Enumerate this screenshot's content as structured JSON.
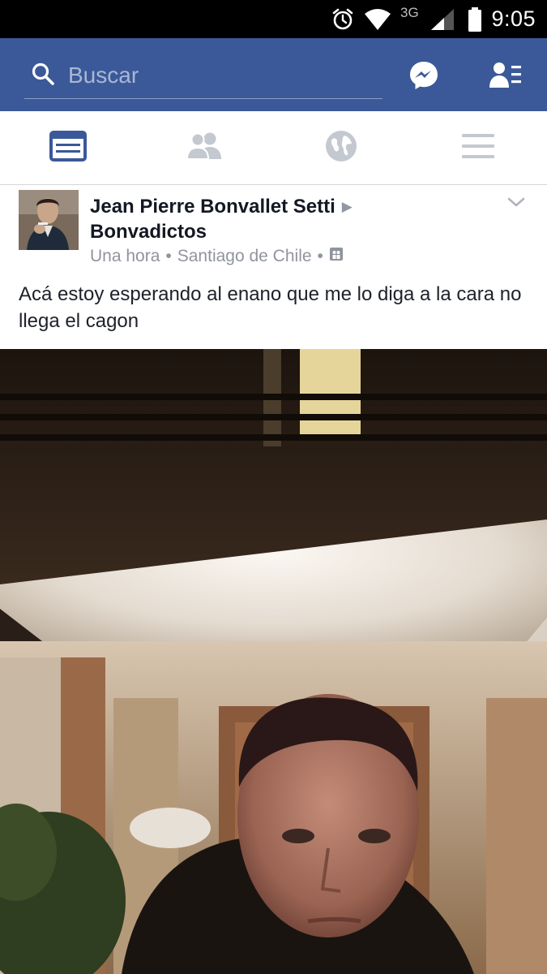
{
  "status_bar": {
    "network": "3G",
    "time": "9:05",
    "icons": [
      "alarm-icon",
      "wifi-icon",
      "signal-icon",
      "battery-icon"
    ]
  },
  "header": {
    "search": {
      "placeholder": "Buscar",
      "value": ""
    },
    "icons": [
      "search-icon",
      "messenger-icon",
      "friend-requests-icon"
    ],
    "background": "#3b5998"
  },
  "nav": {
    "tabs": [
      {
        "name": "news-feed",
        "icon": "news-feed-icon",
        "active": true
      },
      {
        "name": "friends",
        "icon": "friends-icon",
        "active": false
      },
      {
        "name": "notifications",
        "icon": "globe-icon",
        "active": false
      },
      {
        "name": "menu",
        "icon": "menu-icon",
        "active": false
      }
    ],
    "active_color": "#3b5998",
    "inactive_color": "#c4c8d0"
  },
  "post": {
    "author": "Jean Pierre Bonvallet Setti",
    "group": "Bonvadictos",
    "time": "Una hora",
    "location": "Santiago de Chile",
    "privacy_icon": "group-audience-icon",
    "text": "Acá estoy esperando al enano que me lo diga a la cara no llega el cagon",
    "photo_description_icon": "post-photo"
  }
}
